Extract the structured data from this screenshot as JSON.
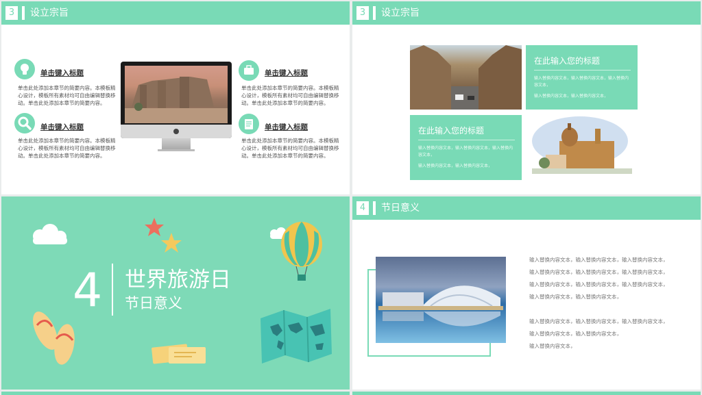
{
  "slide1": {
    "header": {
      "number": "3",
      "title": "设立宗旨"
    },
    "features": [
      {
        "icon": "lightbulb-icon",
        "title": "单击键入标题",
        "body": "单击此处添加本章节的简要内容。本模板精心设计，模板所有素材均可自由编辑替换移动。单击此处添加本章节的简要内容。"
      },
      {
        "icon": "search-icon",
        "title": "单击键入标题",
        "body": "单击此处添加本章节的简要内容。本模板精心设计，模板所有素材均可自由编辑替换移动。单击此处添加本章节的简要内容。"
      },
      {
        "icon": "briefcase-icon",
        "title": "单击键入标题",
        "body": "单击此处添加本章节的简要内容。本模板精心设计，模板所有素材均可自由编辑替换移动。单击此处添加本章节的简要内容。"
      },
      {
        "icon": "document-icon",
        "title": "单击键入标题",
        "body": "单击此处添加本章节的简要内容。本模板精心设计，模板所有素材均可自由编辑替换移动。单击此处添加本章节的简要内容。"
      }
    ]
  },
  "slide2": {
    "header": {
      "number": "3",
      "title": "设立宗旨"
    },
    "box1": {
      "title": "在此输入您的标题",
      "text1": "输入替换内容文本，输入替换内容文本，输入替换内容文本，",
      "text2": "输入替换内容文本，输入替换内容文本，"
    },
    "box2": {
      "title": "在此输入您的标题",
      "text1": "输入替换内容文本，输入替换内容文本，输入替换内容文本，",
      "text2": "输入替换内容文本，输入替换内容文本，"
    }
  },
  "slide3": {
    "number": "4",
    "title": "世界旅游日",
    "subtitle": "节日意义"
  },
  "slide4": {
    "header": {
      "number": "4",
      "title": "节日意义"
    },
    "lines": [
      "输入替换内容文本，输入替换内容文本，输入替换内容文本，",
      "输入替换内容文本，输入替换内容文本，输入替换内容文本，",
      "输入替换内容文本，输入替换内容文本，输入替换内容文本，",
      "输入替换内容文本，输入替换内容文本，",
      "输入替换内容文本，输入替换内容文本，输入替换内容文本，",
      "输入替换内容文本，输入替换内容文本，",
      "输入替换内容文本，"
    ]
  },
  "colors": {
    "accent": "#79dab6",
    "background": "#e9ecec"
  }
}
